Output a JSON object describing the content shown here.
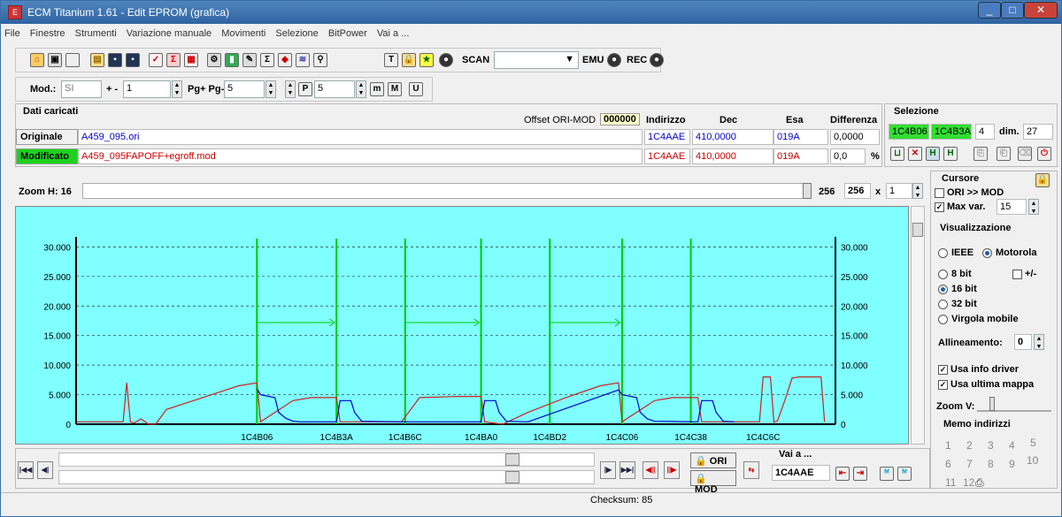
{
  "window": {
    "title": "ECM Titanium 1.61 - Edit EPROM (grafica)"
  },
  "menu": [
    "File",
    "Finestre",
    "Strumenti",
    "Variazione manuale",
    "Movimenti",
    "Selezione",
    "BitPower",
    "Vai a ..."
  ],
  "toolbar": {
    "scan_label": "SCAN",
    "emu_label": "EMU",
    "rec_label": "REC",
    "scan_value": ""
  },
  "toolbar2": {
    "mod_label": "Mod.:",
    "mod_value": "SI",
    "plusminus_label": "+ -",
    "plusminus_value": "1",
    "pg_label": "Pg+ Pg-",
    "pg_value": "5",
    "p_value": "5"
  },
  "dati": {
    "title": "Dati caricati",
    "offset_label": "Offset ORI-MOD",
    "offset_value": "000000",
    "headers": {
      "addr": "Indirizzo",
      "dec": "Dec",
      "esa": "Esa",
      "diff": "Differenza"
    },
    "orig": {
      "label": "Originale",
      "file": "A459_095.ori",
      "addr": "1C4AAE",
      "dec": "410,0000",
      "esa": "019A",
      "diff": "0,0000"
    },
    "mod": {
      "label": "Modificato",
      "file": "A459_095FAPOFF+egroff.mod",
      "addr": "1C4AAE",
      "dec": "410,0000",
      "esa": "019A",
      "diff": "0,0",
      "pct": "%"
    }
  },
  "selezione": {
    "title": "Selezione",
    "start": "1C4B06",
    "end": "1C4B3A",
    "count": "4",
    "dim_label": "dim.",
    "dim_value": "27"
  },
  "zoom": {
    "label": "Zoom H: 16",
    "v1": "256",
    "v2": "256",
    "mult": "x",
    "mult_value": "1"
  },
  "cursore": {
    "title": "Cursore",
    "ori_mod": "ORI >> MOD",
    "max_var_label": "Max var.",
    "max_var_value": "15"
  },
  "visual": {
    "title": "Visualizzazione",
    "ieee": "IEEE",
    "motorola": "Motorola",
    "b8": "8 bit",
    "pm": "+/-",
    "b16": "16 bit",
    "b32": "32 bit",
    "virgola": "Virgola mobile",
    "allineamento_label": "Allineamento:",
    "allineamento_value": "0",
    "usa_info": "Usa info driver",
    "usa_ultima": "Usa ultima mappa",
    "zoomv": "Zoom V:"
  },
  "memo": {
    "title": "Memo indirizzi",
    "items": [
      "1",
      "2",
      "3",
      "4",
      "5",
      "6",
      "7",
      "8",
      "9",
      "10",
      "11",
      "12"
    ]
  },
  "bottom": {
    "ori": "ORI",
    "mod": "MOD",
    "vai_label": "Vai a ...",
    "vai_value": "1C4AAE",
    "checksum": "Checksum: 85"
  },
  "chart_data": {
    "type": "line",
    "y_ticks": [
      "0",
      "5.000",
      "10.000",
      "15.000",
      "20.000",
      "25.000",
      "30.000"
    ],
    "ylim": [
      0,
      33500
    ],
    "x_ticks": [
      "1C4B06",
      "1C4B3A",
      "1C4B6C",
      "1C4BA0",
      "1C4BD2",
      "1C4C06",
      "1C4C38",
      "1C4C6C"
    ],
    "colors": {
      "ori": "#0000cc",
      "mod": "#cc2222",
      "grid": "#333333",
      "sel": "#00cc00",
      "bg": "#7fffff"
    },
    "series": [
      {
        "values": [
          [
            0,
            400
          ],
          [
            5,
            400
          ],
          [
            10,
            400
          ],
          [
            13,
            400
          ],
          [
            14,
            7000
          ],
          [
            15,
            400
          ],
          [
            16,
            200
          ],
          [
            18,
            900
          ],
          [
            20,
            0
          ],
          [
            22,
            0
          ],
          [
            25,
            2500
          ],
          [
            35,
            4500
          ],
          [
            45,
            6500
          ],
          [
            50,
            7000
          ],
          [
            51,
            400
          ],
          [
            60,
            4000
          ],
          [
            65,
            4500
          ],
          [
            72,
            4500
          ],
          [
            73,
            400
          ],
          [
            80,
            400
          ],
          [
            90,
            400
          ],
          [
            95,
            4500
          ],
          [
            105,
            4700
          ],
          [
            112,
            4700
          ],
          [
            113,
            400
          ],
          [
            118,
            0
          ],
          [
            125,
            2000
          ],
          [
            135,
            4400
          ],
          [
            145,
            6500
          ],
          [
            150,
            7000
          ],
          [
            151,
            400
          ],
          [
            160,
            4000
          ],
          [
            165,
            4500
          ],
          [
            172,
            4500
          ],
          [
            173,
            400
          ],
          [
            180,
            400
          ],
          [
            189,
            400
          ],
          [
            190,
            8000
          ],
          [
            192,
            8000
          ],
          [
            193,
            300
          ],
          [
            194,
            600
          ],
          [
            196,
            4000
          ],
          [
            198,
            7800
          ],
          [
            200,
            8000
          ],
          [
            206,
            8000
          ],
          [
            207,
            400
          ]
        ]
      },
      {
        "values": [
          [
            50,
            6000
          ],
          [
            51,
            5000
          ],
          [
            55,
            4500
          ],
          [
            56,
            2000
          ],
          [
            58,
            1000
          ],
          [
            60,
            500
          ],
          [
            62,
            400
          ],
          [
            72,
            400
          ],
          [
            73,
            4000
          ],
          [
            76,
            4000
          ],
          [
            77,
            2000
          ],
          [
            79,
            500
          ],
          [
            90,
            400
          ],
          [
            112,
            400
          ],
          [
            113,
            4000
          ],
          [
            116,
            4000
          ],
          [
            117,
            2000
          ],
          [
            119,
            500
          ],
          [
            125,
            400
          ],
          [
            150,
            5800
          ],
          [
            151,
            5000
          ],
          [
            155,
            4500
          ],
          [
            156,
            2000
          ],
          [
            158,
            900
          ],
          [
            160,
            500
          ],
          [
            172,
            400
          ],
          [
            173,
            4000
          ],
          [
            176,
            4000
          ],
          [
            177,
            2000
          ],
          [
            179,
            500
          ],
          [
            182,
            400
          ]
        ]
      }
    ],
    "sel_markers": [
      50,
      72,
      91,
      112,
      131,
      151,
      170
    ]
  }
}
